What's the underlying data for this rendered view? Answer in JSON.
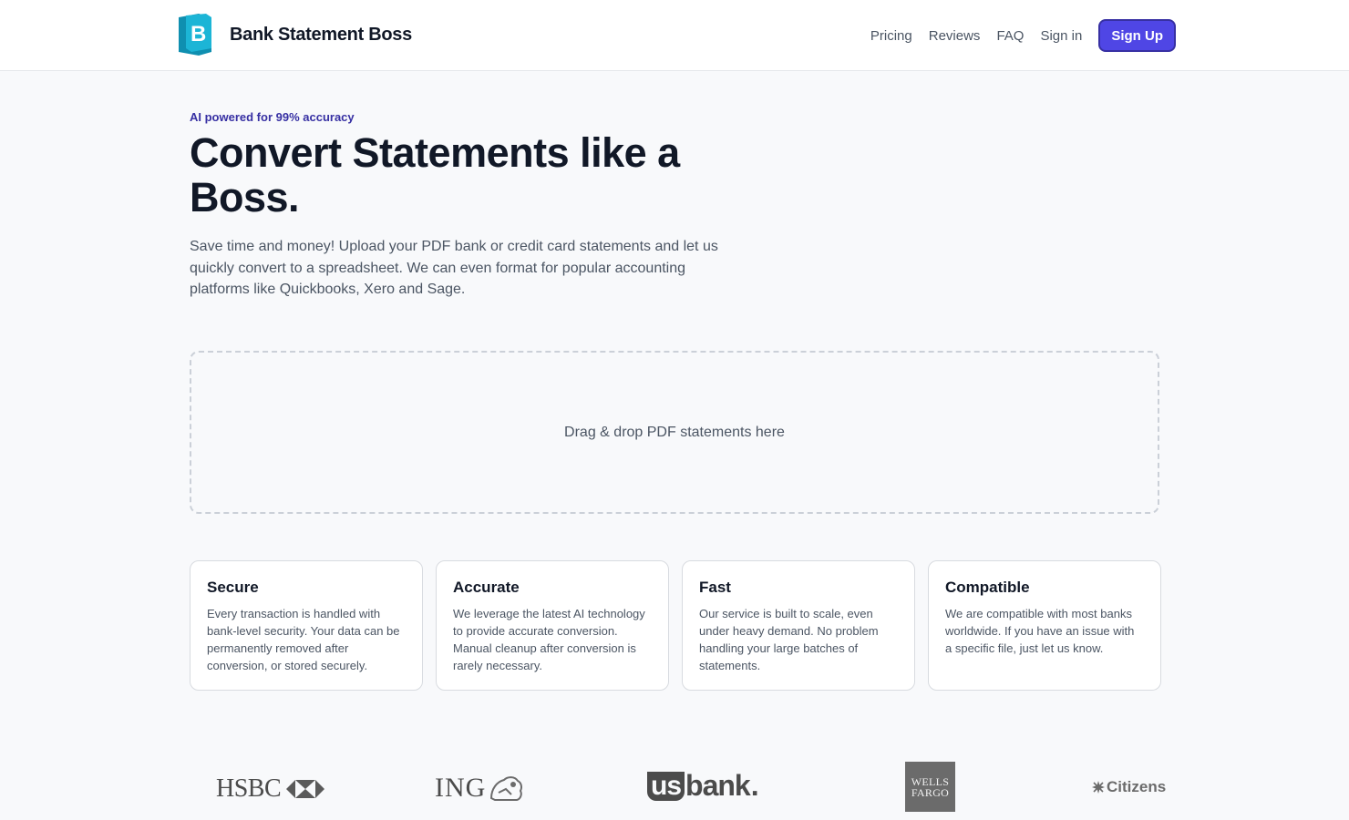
{
  "header": {
    "brand_name": "Bank Statement Boss",
    "logo_letter": "B",
    "nav": {
      "pricing": "Pricing",
      "reviews": "Reviews",
      "faq": "FAQ",
      "sign_in": "Sign in",
      "sign_up": "Sign Up"
    }
  },
  "hero": {
    "eyebrow": "AI powered for 99% accuracy",
    "title": "Convert Statements like a Boss.",
    "description": "Save time and money! Upload your PDF bank or credit card statements and let us quickly convert to a spreadsheet. We can even format for popular accounting platforms like Quickbooks, Xero and Sage."
  },
  "dropzone": {
    "label": "Drag & drop PDF statements here"
  },
  "features": [
    {
      "title": "Secure",
      "text": "Every transaction is handled with bank-level security. Your data can be permanently removed after conversion, or stored securely."
    },
    {
      "title": "Accurate",
      "text": "We leverage the latest AI technology to provide accurate conversion. Manual cleanup after conversion is rarely necessary."
    },
    {
      "title": "Fast",
      "text": "Our service is built to scale, even under heavy demand. No problem handling your large batches of statements."
    },
    {
      "title": "Compatible",
      "text": "We are compatible with most banks worldwide. If you have an issue with a specific file, just let us know."
    }
  ],
  "banks": {
    "hsbc": "HSBC",
    "ing": "ING",
    "usbank_us": "us",
    "usbank_bank": "bank",
    "usbank_dot": ".",
    "wells_line1": "WELLS",
    "wells_line2": "FARGO",
    "citizens": "Citizens"
  },
  "colors": {
    "accent": "#4f46e5",
    "eyebrow": "#3730a3",
    "logo_teal": "#1aa3c4"
  }
}
